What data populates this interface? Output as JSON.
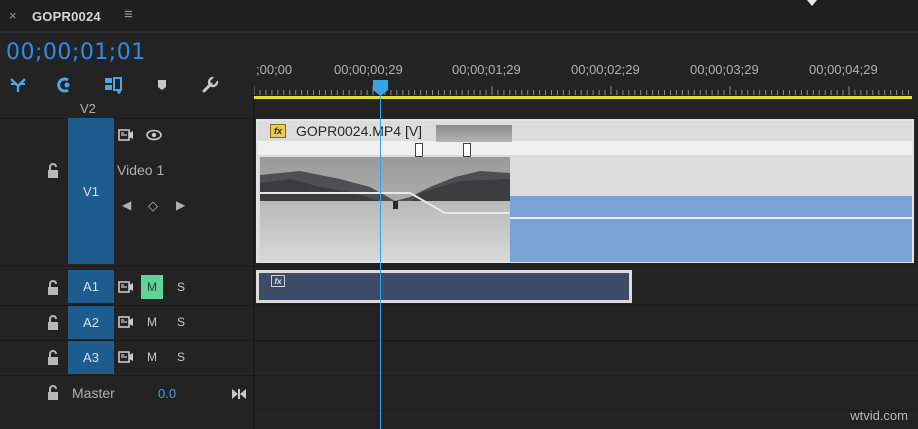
{
  "tab": {
    "close_glyph": "×",
    "title": "GOPR0024",
    "menu_glyph": "≡"
  },
  "timecode": "00;00;01;01",
  "tools": [
    "snap-icon",
    "linked-selection-icon",
    "insert-sequence-icon",
    "add-marker-icon",
    "wrench-icon"
  ],
  "ruler": {
    "labels": [
      ";00;00",
      "00;00;00;29",
      "00;00;01;29",
      "00;00;02;29",
      "00;00;03;29",
      "00;00;04;29"
    ]
  },
  "tracks": {
    "v2": {
      "name": "V2"
    },
    "v1": {
      "name": "V1",
      "label": "Video 1"
    },
    "a1": {
      "name": "A1",
      "mute": "M",
      "solo": "S"
    },
    "a2": {
      "name": "A2",
      "mute": "M",
      "solo": "S"
    },
    "a3": {
      "name": "A3",
      "mute": "M",
      "solo": "S"
    },
    "master": {
      "label": "Master",
      "value": "0.0"
    }
  },
  "keyframe_nav": {
    "prev": "◀",
    "add": "◇",
    "next": "▶"
  },
  "clips": {
    "video": {
      "fx": "fx",
      "name": "GOPR0024.MP4 [V]"
    },
    "audio": {
      "fx": "fx"
    }
  },
  "watermark": "wtvid.com",
  "colors": {
    "timecode": "#2d8ceb",
    "playhead": "#3aa3e6",
    "track_target": "#1e5c8f",
    "mute_active": "#5fd39a",
    "work_area": "#e6dd2e",
    "video_clip_fill": "#7aa3d4",
    "audio_clip_fill": "#3c4c68"
  }
}
